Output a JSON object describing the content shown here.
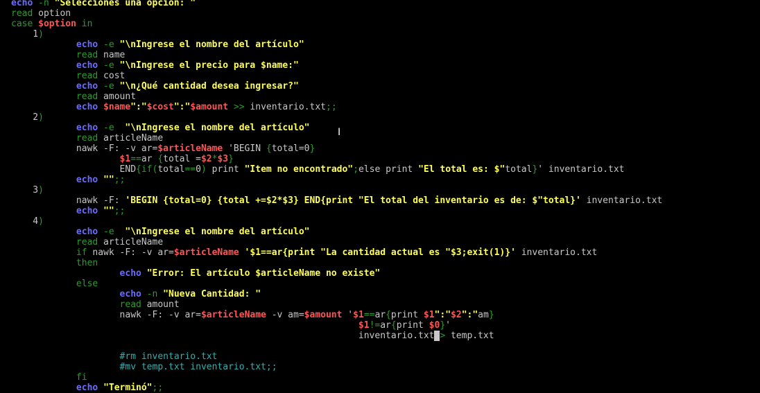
{
  "editor": {
    "lines": [
      [
        [
          "echo",
          "cmd"
        ],
        [
          " -n ",
          "opt"
        ],
        [
          "\"Selecciones una opción: \"",
          "str"
        ]
      ],
      [
        [
          "read",
          "kw"
        ],
        [
          " option",
          "txt"
        ]
      ],
      [
        [
          "case ",
          "kw"
        ],
        [
          "$option",
          "var"
        ],
        [
          " in",
          "kw"
        ]
      ],
      [
        [
          "    1",
          "txt"
        ],
        [
          ")",
          "grn"
        ]
      ],
      [
        [
          "            ",
          ""
        ],
        [
          "echo",
          "cmd"
        ],
        [
          " -e ",
          "opt"
        ],
        [
          "\"\\nIngrese el nombre del artículo\"",
          "str"
        ]
      ],
      [
        [
          "            ",
          ""
        ],
        [
          "read",
          "kw"
        ],
        [
          " name",
          "txt"
        ]
      ],
      [
        [
          "            ",
          ""
        ],
        [
          "echo",
          "cmd"
        ],
        [
          " -e ",
          "opt"
        ],
        [
          "\"\\nIngrese el precio para $name:\"",
          "str"
        ]
      ],
      [
        [
          "            ",
          ""
        ],
        [
          "read",
          "kw"
        ],
        [
          " cost",
          "txt"
        ]
      ],
      [
        [
          "            ",
          ""
        ],
        [
          "echo",
          "cmd"
        ],
        [
          " -e ",
          "opt"
        ],
        [
          "\"\\n¿Qué cantidad desea ingresar?\"",
          "str"
        ]
      ],
      [
        [
          "            ",
          ""
        ],
        [
          "read",
          "kw"
        ],
        [
          " amount",
          "txt"
        ]
      ],
      [
        [
          "            ",
          ""
        ],
        [
          "echo ",
          "cmd"
        ],
        [
          "$name",
          "var"
        ],
        [
          "\":\"",
          "str"
        ],
        [
          "$cost",
          "var"
        ],
        [
          "\":\"",
          "str"
        ],
        [
          "$amount",
          "var"
        ],
        [
          " >> ",
          "grn"
        ],
        [
          "inventario.txt",
          "txt"
        ],
        [
          ";;",
          "grn"
        ]
      ],
      [
        [
          "    2",
          "txt"
        ],
        [
          ")",
          "grn"
        ]
      ],
      [
        [
          "            ",
          ""
        ],
        [
          "echo",
          "cmd"
        ],
        [
          " -e  ",
          "opt"
        ],
        [
          "\"\\nIngrese el nombre del artículo\"",
          "str"
        ]
      ],
      [
        [
          "            ",
          ""
        ],
        [
          "read",
          "kw"
        ],
        [
          " articleName",
          "txt"
        ]
      ],
      [
        [
          "            ",
          ""
        ],
        [
          "nawk -F: -v ar=",
          "txt"
        ],
        [
          "$articleName",
          "var"
        ],
        [
          " 'BEGIN ",
          "txt"
        ],
        [
          "{",
          "grn"
        ],
        [
          "total=0",
          "txt"
        ],
        [
          "}",
          "grn"
        ]
      ],
      [
        [
          "                    ",
          ""
        ],
        [
          "$1",
          "var"
        ],
        [
          "==",
          "grn"
        ],
        [
          "ar ",
          "txt"
        ],
        [
          "{",
          "grn"
        ],
        [
          "total =",
          "txt"
        ],
        [
          "$2",
          "var"
        ],
        [
          "*",
          "grn"
        ],
        [
          "$3",
          "var"
        ],
        [
          "}",
          "grn"
        ]
      ],
      [
        [
          "                    ",
          ""
        ],
        [
          "END",
          "txt"
        ],
        [
          "{",
          "grn"
        ],
        [
          "if",
          "grn"
        ],
        [
          "(",
          "grn"
        ],
        [
          "total",
          "txt"
        ],
        [
          "==",
          "grn"
        ],
        [
          "0",
          "txt"
        ],
        [
          ")",
          "grn"
        ],
        [
          " print ",
          "txt"
        ],
        [
          "\"Item no encontrado\"",
          "str"
        ],
        [
          ";",
          "grn"
        ],
        [
          "else print ",
          "txt"
        ],
        [
          "\"El total es: $\"",
          "str"
        ],
        [
          "total",
          "txt"
        ],
        [
          "}",
          "grn"
        ],
        [
          "' inventario.txt",
          "txt"
        ]
      ],
      [
        [
          "            ",
          ""
        ],
        [
          "echo ",
          "cmd"
        ],
        [
          "\"\"",
          "str"
        ],
        [
          ";;",
          "grn"
        ]
      ],
      [
        [
          "    3",
          "txt"
        ],
        [
          ")",
          "grn"
        ]
      ],
      [
        [
          "            ",
          ""
        ],
        [
          "nawk -F: ",
          "txt"
        ],
        [
          "'BEGIN {total=0} {total +=$2*$3} END{print \"El total del inventario es de: $\"total}'",
          "str"
        ],
        [
          " inventario.txt",
          "txt"
        ]
      ],
      [
        [
          "            ",
          ""
        ],
        [
          "echo ",
          "cmd"
        ],
        [
          "\"\"",
          "str"
        ],
        [
          ";;",
          "grn"
        ]
      ],
      [
        [
          "    4",
          "txt"
        ],
        [
          ")",
          "grn"
        ]
      ],
      [
        [
          "            ",
          ""
        ],
        [
          "echo",
          "cmd"
        ],
        [
          " -e  ",
          "opt"
        ],
        [
          "\"\\nIngrese el nombre del artículo\"",
          "str"
        ]
      ],
      [
        [
          "            ",
          ""
        ],
        [
          "read",
          "kw"
        ],
        [
          " articleName",
          "txt"
        ]
      ],
      [
        [
          "            ",
          ""
        ],
        [
          "if",
          "kw"
        ],
        [
          " nawk -F: -v ar=",
          "txt"
        ],
        [
          "$articleName",
          "var"
        ],
        [
          " '$1==ar{print \"La cantidad actual es \"$3;exit(1)}'",
          "str"
        ],
        [
          " inventario.txt",
          "txt"
        ]
      ],
      [
        [
          "            ",
          ""
        ],
        [
          "then",
          "kw"
        ]
      ],
      [
        [
          "                    ",
          ""
        ],
        [
          "echo ",
          "cmd"
        ],
        [
          "\"Error: El artículo $articleName no existe\"",
          "str"
        ]
      ],
      [
        [
          "            ",
          ""
        ],
        [
          "else",
          "kw"
        ]
      ],
      [
        [
          "                    ",
          ""
        ],
        [
          "echo",
          "cmd"
        ],
        [
          " -n ",
          "opt"
        ],
        [
          "\"Nueva Cantidad: \"",
          "str"
        ]
      ],
      [
        [
          "                    ",
          ""
        ],
        [
          "read",
          "kw"
        ],
        [
          " amount",
          "txt"
        ]
      ],
      [
        [
          "                    ",
          ""
        ],
        [
          "nawk -F: -v ar=",
          "txt"
        ],
        [
          "$articleName",
          "var"
        ],
        [
          " -v am=",
          "txt"
        ],
        [
          "$amount",
          "var"
        ],
        [
          " '",
          "txt"
        ],
        [
          "$1",
          "var"
        ],
        [
          "==",
          "grn"
        ],
        [
          "ar",
          "txt"
        ],
        [
          "{",
          "grn"
        ],
        [
          "print ",
          "txt"
        ],
        [
          "$1",
          "var"
        ],
        [
          "\":\"",
          "str"
        ],
        [
          "$2",
          "var"
        ],
        [
          "\":\"",
          "str"
        ],
        [
          "am",
          "txt"
        ],
        [
          "}",
          "grn"
        ]
      ],
      [
        [
          "                                                                ",
          ""
        ],
        [
          "$1",
          "var"
        ],
        [
          "!=",
          "grn"
        ],
        [
          "ar",
          "txt"
        ],
        [
          "{",
          "grn"
        ],
        [
          "print ",
          "txt"
        ],
        [
          "$0",
          "var"
        ],
        [
          "}",
          "grn"
        ],
        [
          "'",
          "txt"
        ]
      ],
      [
        [
          "                                                                ",
          ""
        ],
        [
          "inventario.txt",
          "txt"
        ],
        [
          " ",
          "cur"
        ],
        [
          "> ",
          "grn"
        ],
        [
          "temp.txt",
          "txt"
        ]
      ],
      [
        [
          "",
          ""
        ]
      ],
      [
        [
          "                    ",
          ""
        ],
        [
          "#rm inventario.txt",
          "cmt"
        ]
      ],
      [
        [
          "                    ",
          ""
        ],
        [
          "#mv temp.txt inventario.txt;;",
          "cmt"
        ]
      ],
      [
        [
          "            ",
          ""
        ],
        [
          "fi",
          "kw"
        ]
      ],
      [
        [
          "            ",
          ""
        ],
        [
          "echo ",
          "cmd"
        ],
        [
          "\"Terminó\"",
          "str"
        ],
        [
          ";;",
          "grn"
        ]
      ]
    ]
  },
  "colors": {
    "background": "#000000",
    "keyword": "#2a9d2a",
    "command": "#6b6bff",
    "string": "#ffff55",
    "variable": "#ff5555",
    "comment": "#30b0b0",
    "plain": "#c8c8c8"
  },
  "mouse_pointer": {
    "icon": "text-cursor-ibeam-icon",
    "glyph": "I"
  }
}
